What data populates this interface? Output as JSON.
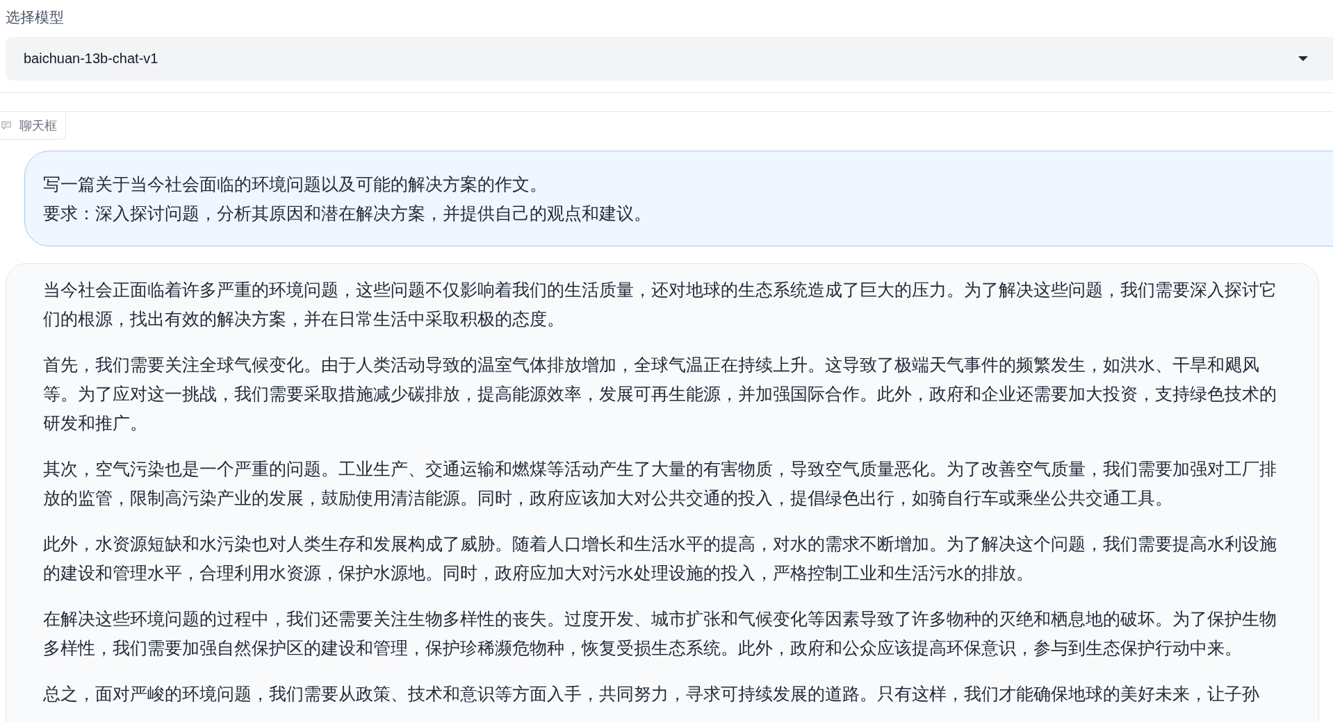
{
  "model_select": {
    "label": "选择模型",
    "value": "baichuan-13b-chat-v1"
  },
  "chat_tab": {
    "label": "聊天框",
    "selected": true
  },
  "messages": [
    {
      "kind": "user",
      "paragraphs": [
        "写一篇关于当今社会面临的环境问题以及可能的解决方案的作文。",
        "要求：深入探讨问题，分析其原因和潜在解决方案，并提供自己的观点和建议。"
      ]
    },
    {
      "kind": "bot",
      "paragraphs": [
        "当今社会正面临着许多严重的环境问题，这些问题不仅影响着我们的生活质量，还对地球的生态系统造成了巨大的压力。为了解决这些问题，我们需要深入探讨它们的根源，找出有效的解决方案，并在日常生活中采取积极的态度。",
        "首先，我们需要关注全球气候变化。由于人类活动导致的温室气体排放增加，全球气温正在持续上升。这导致了极端天气事件的频繁发生，如洪水、干旱和飓风等。为了应对这一挑战，我们需要采取措施减少碳排放，提高能源效率，发展可再生能源，并加强国际合作。此外，政府和企业还需要加大投资，支持绿色技术的研发和推广。",
        "其次，空气污染也是一个严重的问题。工业生产、交通运输和燃煤等活动产生了大量的有害物质，导致空气质量恶化。为了改善空气质量，我们需要加强对工厂排放的监管，限制高污染产业的发展，鼓励使用清洁能源。同时，政府应该加大对公共交通的投入，提倡绿色出行，如骑自行车或乘坐公共交通工具。",
        "此外，水资源短缺和水污染也对人类生存和发展构成了威胁。随着人口增长和生活水平的提高，对水的需求不断增加。为了解决这个问题，我们需要提高水利设施的建设和管理水平，合理利用水资源，保护水源地。同时，政府应加大对污水处理设施的投入，严格控制工业和生活污水的排放。",
        "在解决这些环境问题的过程中，我们还需要关注生物多样性的丧失。过度开发、城市扩张和气候变化等因素导致了许多物种的灭绝和栖息地的破坏。为了保护生物多样性，我们需要加强自然保护区的建设和管理，保护珍稀濒危物种，恢复受损生态系统。此外，政府和公众应该提高环保意识，参与到生态保护行动中来。",
        "总之，面对严峻的环境问题，我们需要从政策、技术和意识等方面入手，共同努力，寻求可持续发展的道路。只有这样，我们才能确保地球的美好未来，让子孙"
      ]
    }
  ]
}
